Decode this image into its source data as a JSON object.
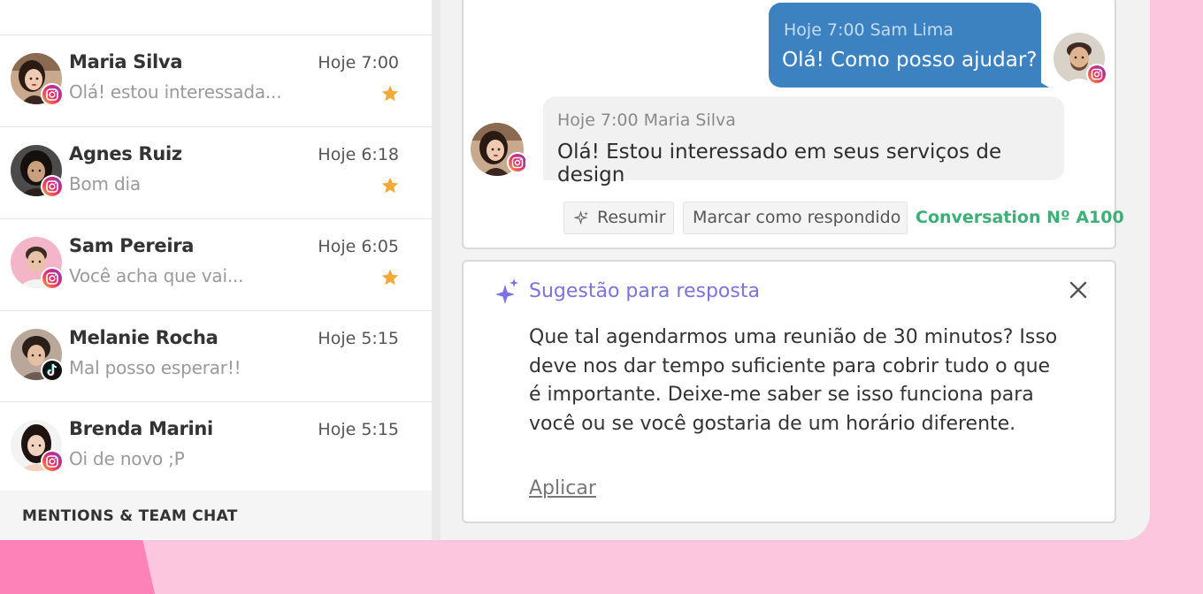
{
  "colors": {
    "accent_blue": "#3c82c0",
    "suggestion_purple": "#7b73e0",
    "conversation_green": "#3daf78",
    "star": "#f4a934",
    "background_pink": "#fcc6de"
  },
  "conversations": [
    {
      "name": "Maria Silva",
      "time": "Hoje 7:00",
      "preview": "Olá! estou interessada...",
      "starred": true,
      "channel": "instagram-icon"
    },
    {
      "name": "Agnes Ruiz",
      "time": "Hoje 6:18",
      "preview": "Bom dia",
      "starred": true,
      "channel": "instagram-icon"
    },
    {
      "name": "Sam Pereira",
      "time": "Hoje 6:05",
      "preview": "Você acha que vai...",
      "starred": true,
      "channel": "instagram-icon"
    },
    {
      "name": "Melanie Rocha",
      "time": "Hoje 5:15",
      "preview": "Mal posso esperar!!",
      "starred": false,
      "channel": "tiktok-icon"
    },
    {
      "name": "Brenda Marini",
      "time": "Hoje 5:15",
      "preview": "Oi de novo ;P",
      "starred": false,
      "channel": "instagram-icon"
    }
  ],
  "sidebar": {
    "mentions_label": "MENTIONS & TEAM CHAT"
  },
  "chat": {
    "outgoing": {
      "meta": "Hoje 7:00 Sam Lima",
      "text": "Olá! Como posso ajudar?"
    },
    "incoming": {
      "meta": "Hoje 7:00 Maria Silva",
      "text": "Olá! Estou interessado em seus serviços de design"
    },
    "actions": {
      "summarize_label": "Resumir",
      "mark_answered_label": "Marcar como respondido",
      "conversation_number": "Conversation Nº A100"
    }
  },
  "suggestion": {
    "title": "Sugestão para resposta",
    "body": "Que tal agendarmos uma reunião de 30 minutos? Isso deve nos dar tempo suficiente para cobrir tudo o que é importante. Deixe-me saber se isso funciona para você ou se você gostaria de um horário diferente.",
    "apply_label": "Aplicar"
  }
}
